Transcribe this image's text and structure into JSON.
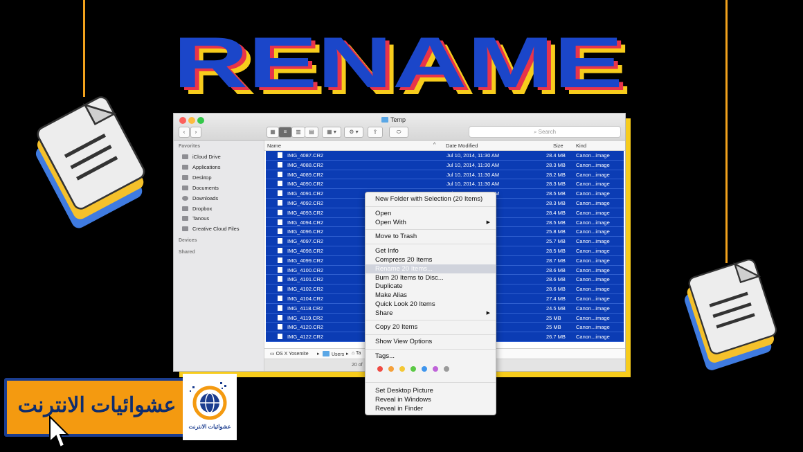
{
  "headline": "RENAME",
  "window": {
    "title": "Temp",
    "search_placeholder": "Search",
    "nav_back": "‹",
    "nav_forward": "›",
    "sidebar": {
      "favorites_heading": "Favorites",
      "favorites": [
        "iCloud Drive",
        "Applications",
        "Desktop",
        "Documents",
        "Downloads",
        "Dropbox",
        "Tanous",
        "Creative Cloud Files"
      ],
      "devices_heading": "Devices",
      "shared_heading": "Shared"
    },
    "columns": {
      "name": "Name",
      "date": "Date Modified",
      "size": "Size",
      "kind": "Kind"
    },
    "files": [
      {
        "name": "IMG_4087.CR2",
        "date": "Jul 10, 2014, 11:30 AM",
        "size": "28.4 MB",
        "kind": "Canon...image"
      },
      {
        "name": "IMG_4088.CR2",
        "date": "Jul 10, 2014, 11:30 AM",
        "size": "28.3 MB",
        "kind": "Canon...image"
      },
      {
        "name": "IMG_4089.CR2",
        "date": "Jul 10, 2014, 11:30 AM",
        "size": "28.2 MB",
        "kind": "Canon...image"
      },
      {
        "name": "IMG_4090.CR2",
        "date": "Jul 10, 2014, 11:30 AM",
        "size": "28.3 MB",
        "kind": "Canon...image"
      },
      {
        "name": "IMG_4091.CR2",
        "date": "Jul 10, 2014, 11:30 AM",
        "size": "28.5 MB",
        "kind": "Canon...image"
      },
      {
        "name": "IMG_4092.CR2",
        "date": "",
        "size": "28.3 MB",
        "kind": "Canon...image"
      },
      {
        "name": "IMG_4093.CR2",
        "date": "",
        "size": "28.4 MB",
        "kind": "Canon...image"
      },
      {
        "name": "IMG_4094.CR2",
        "date": "",
        "size": "28.5 MB",
        "kind": "Canon...image"
      },
      {
        "name": "IMG_4096.CR2",
        "date": "",
        "size": "25.8 MB",
        "kind": "Canon...image"
      },
      {
        "name": "IMG_4097.CR2",
        "date": "",
        "size": "25.7 MB",
        "kind": "Canon...image"
      },
      {
        "name": "IMG_4098.CR2",
        "date": "",
        "size": "28.5 MB",
        "kind": "Canon...image"
      },
      {
        "name": "IMG_4099.CR2",
        "date": "",
        "size": "28.7 MB",
        "kind": "Canon...image"
      },
      {
        "name": "IMG_4100.CR2",
        "date": "",
        "size": "28.6 MB",
        "kind": "Canon...image"
      },
      {
        "name": "IMG_4101.CR2",
        "date": "",
        "size": "28.6 MB",
        "kind": "Canon...image"
      },
      {
        "name": "IMG_4102.CR2",
        "date": "",
        "size": "28.6 MB",
        "kind": "Canon...image"
      },
      {
        "name": "IMG_4104.CR2",
        "date": "",
        "size": "27.4 MB",
        "kind": "Canon...image"
      },
      {
        "name": "IMG_4118.CR2",
        "date": "",
        "size": "24.5 MB",
        "kind": "Canon...image"
      },
      {
        "name": "IMG_4119.CR2",
        "date": "",
        "size": "25 MB",
        "kind": "Canon...image"
      },
      {
        "name": "IMG_4120.CR2",
        "date": "",
        "size": "25 MB",
        "kind": "Canon...image"
      },
      {
        "name": "IMG_4122.CR2",
        "date": "",
        "size": "26.7 MB",
        "kind": "Canon...image"
      }
    ],
    "date_tail": [
      "",
      "",
      "",
      "",
      "",
      "",
      "",
      "",
      "",
      "",
      "",
      "",
      "",
      "",
      "",
      "",
      "0 PM",
      "0 PM",
      "0 PM",
      "0 PM"
    ],
    "pathbar": {
      "volume": "OS X Yosemite",
      "users": "Users",
      "home": "Ta"
    },
    "status": "20 of"
  },
  "context_menu": {
    "new_folder": "New Folder with Selection (20 Items)",
    "open": "Open",
    "open_with": "Open With",
    "move_to_trash": "Move to Trash",
    "get_info": "Get Info",
    "compress": "Compress 20 Items",
    "rename": "Rename 20 Items...",
    "burn": "Burn 20 Items to Disc...",
    "duplicate": "Duplicate",
    "make_alias": "Make Alias",
    "quick_look": "Quick Look 20 Items",
    "share": "Share",
    "copy": "Copy 20 Items",
    "show_view_options": "Show View Options",
    "tags": "Tags...",
    "tag_colors": [
      "#ef4b44",
      "#f5a03a",
      "#f4c834",
      "#5bc945",
      "#3f95ed",
      "#bf63d8",
      "#9a9a9a"
    ],
    "set_desktop": "Set Desktop Picture",
    "reveal_windows": "Reveal in Windows",
    "reveal_finder": "Reveal in Finder"
  },
  "brand": {
    "name": "عشوائيات الانترنت",
    "logo_caption": "عشوائيات الانترنت"
  },
  "colors": {
    "headline_blue": "#1b46c9",
    "headline_shadow_yellow": "#f7cc1c",
    "headline_red": "#e8344a",
    "selection_blue": "#0b3cb4",
    "badge_orange": "#f49a10"
  }
}
